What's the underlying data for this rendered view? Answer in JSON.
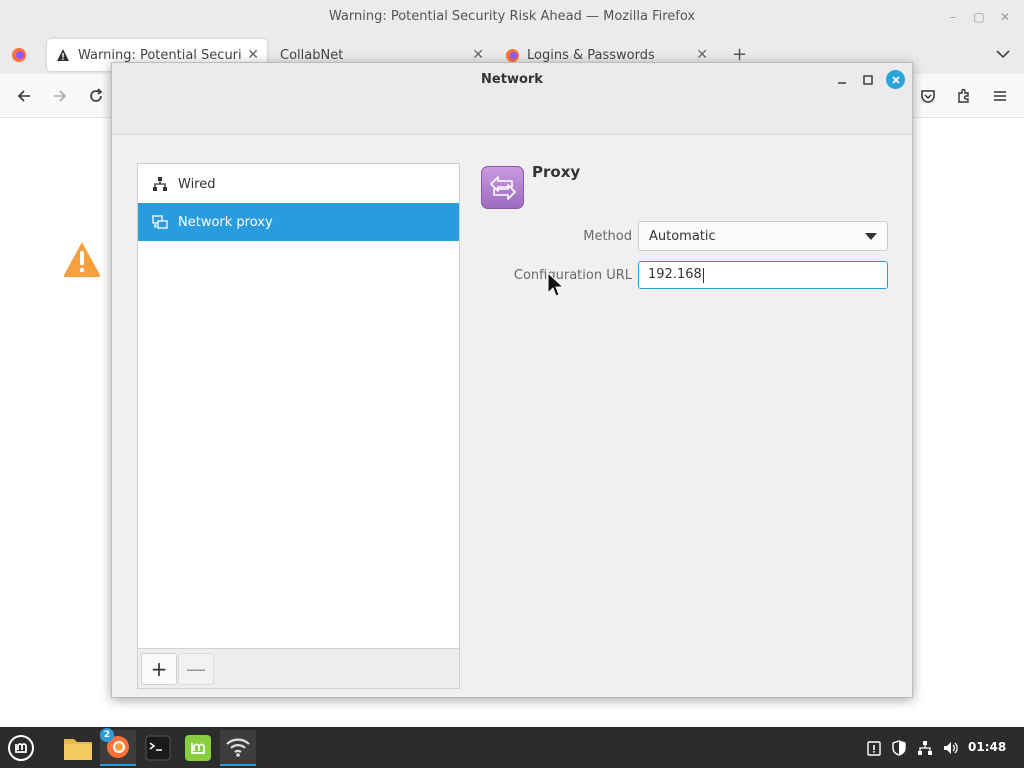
{
  "firefox": {
    "window_title": "Warning: Potential Security Risk Ahead — Mozilla Firefox",
    "tabs": [
      {
        "label": "Warning: Potential Security Risk Ahead",
        "active": true
      },
      {
        "label": "CollabNet",
        "active": false
      },
      {
        "label": "Logins & Passwords",
        "active": false
      }
    ]
  },
  "dialog": {
    "title": "Network",
    "connections": [
      {
        "label": "Wired",
        "icon": "wired-network-icon",
        "selected": false
      },
      {
        "label": "Network proxy",
        "icon": "network-proxy-icon",
        "selected": true
      }
    ],
    "add_label": "+",
    "remove_label": "—",
    "proxy": {
      "heading": "Proxy",
      "method_label": "Method",
      "method_value": "Automatic",
      "url_label": "Configuration URL",
      "url_value": "192.168"
    }
  },
  "taskbar": {
    "firefox_badge": "2",
    "clock": "01:48"
  },
  "colors": {
    "accent": "#2a9cde",
    "warning": "#f5a03c",
    "proxy_icon": "#b47fd4"
  }
}
